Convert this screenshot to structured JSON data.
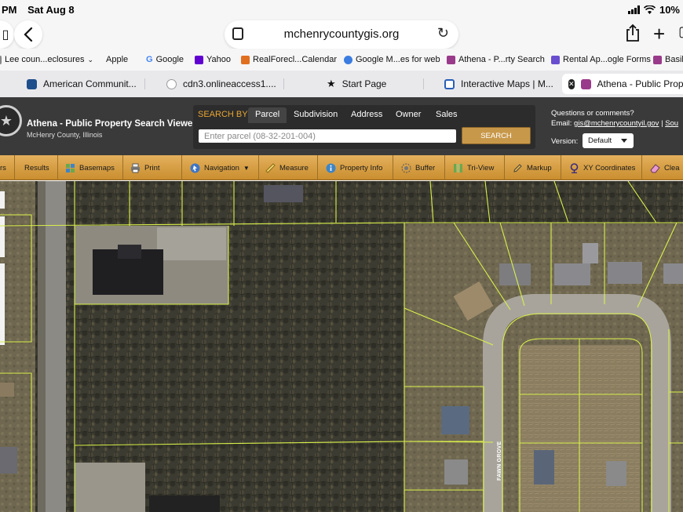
{
  "status_bar": {
    "time": "PM",
    "date": "Sat Aug 8",
    "battery": "10%"
  },
  "browser": {
    "url": "mchenrycountygis.org",
    "bookmarks": [
      {
        "label": "Lee coun...eclosures",
        "icon": "folder-icon",
        "color": "#666666"
      },
      {
        "label": "Apple",
        "icon": "apple-icon",
        "color": "#111111"
      },
      {
        "label": "Google",
        "icon": "google-icon",
        "color": "#4285f4"
      },
      {
        "label": "Yahoo",
        "icon": "yahoo-icon",
        "color": "#6001d2"
      },
      {
        "label": "RealForecl...Calendar",
        "icon": "realforeclose-icon",
        "color": "#e07020"
      },
      {
        "label": "Google M...es for web",
        "icon": "google-maps-icon",
        "color": "#3b7de0"
      },
      {
        "label": "Athena - P...rty Search",
        "icon": "athena-icon",
        "color": "#9a3a8a"
      },
      {
        "label": "Rental Ap...ogle Forms",
        "icon": "forms-icon",
        "color": "#6a4ed0"
      },
      {
        "label": "Basil",
        "icon": "athena-icon",
        "color": "#9a3a8a"
      }
    ],
    "tabs": [
      {
        "label": "American Communit...",
        "icon": "census-icon",
        "color": "#1f4e8c",
        "active": false
      },
      {
        "label": "cdn3.onlineaccess1....",
        "icon": "globe-icon",
        "color": "#9a9a9a",
        "active": false
      },
      {
        "label": "Start Page",
        "icon": "star-icon",
        "color": "#111111",
        "active": false
      },
      {
        "label": "Interactive Maps | M...",
        "icon": "maps-icon",
        "color": "#2a5fb8",
        "active": false
      },
      {
        "label": "Athena - Public Prop...",
        "icon": "athena-icon",
        "color": "#9a3a8a",
        "active": true
      }
    ]
  },
  "app": {
    "title": "Athena - Public Property Search Viewer",
    "subtitle": "McHenry County, Illinois",
    "search": {
      "label": "SEARCH BY:",
      "tabs": [
        "Parcel",
        "Subdivision",
        "Address",
        "Owner",
        "Sales"
      ],
      "active_tab": "Parcel",
      "placeholder": "Enter parcel (08-32-201-004)",
      "button": "SEARCH"
    },
    "contact": {
      "question": "Questions or comments?",
      "email_label": "Email:",
      "email": "gis@mchenrycountyil.gov",
      "separator": "|",
      "extra": "Sou"
    },
    "version": {
      "label": "Version:",
      "value": "Default"
    }
  },
  "toolbar": [
    {
      "label": "rs",
      "icon": "layers-icon"
    },
    {
      "label": "Results",
      "icon": "results-icon"
    },
    {
      "label": "Basemaps",
      "icon": "basemaps-icon"
    },
    {
      "label": "Print",
      "icon": "printer-icon"
    },
    {
      "label": "Navigation",
      "icon": "navigation-icon",
      "dropdown": true
    },
    {
      "label": "Measure",
      "icon": "ruler-icon"
    },
    {
      "label": "Property Info",
      "icon": "info-icon"
    },
    {
      "label": "Buffer",
      "icon": "buffer-icon"
    },
    {
      "label": "Tri-View",
      "icon": "triview-icon"
    },
    {
      "label": "Markup",
      "icon": "pencil-icon"
    },
    {
      "label": "XY Coordinates",
      "icon": "xy-pin-icon"
    },
    {
      "label": "Clea",
      "icon": "eraser-icon"
    }
  ],
  "map": {
    "street_label": "FAWN GROVE"
  }
}
